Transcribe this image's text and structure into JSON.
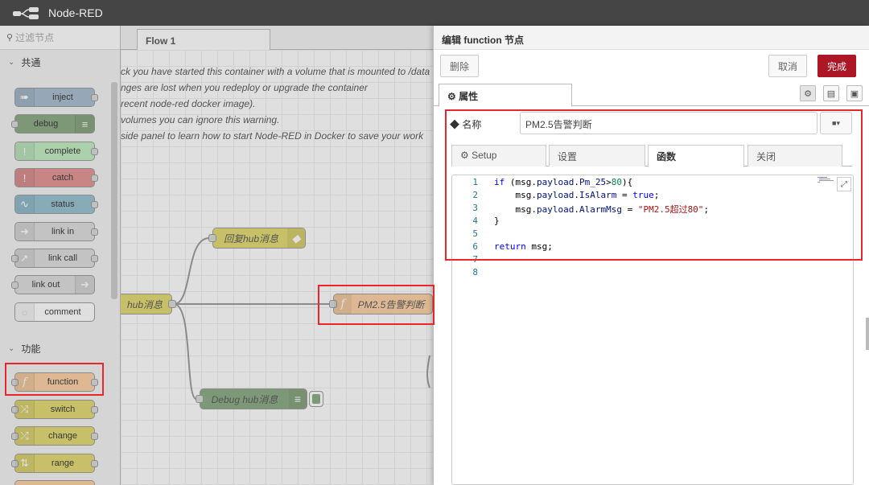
{
  "app": {
    "title": "Node-RED"
  },
  "palette": {
    "search_placeholder": "过滤节点",
    "categories": [
      {
        "label": "共通",
        "nodes": [
          "inject",
          "debug",
          "complete",
          "catch",
          "status",
          "link in",
          "link call",
          "link out",
          "comment"
        ]
      },
      {
        "label": "功能",
        "nodes": [
          "function",
          "switch",
          "change",
          "range"
        ]
      }
    ]
  },
  "workspace": {
    "flow_tab": "Flow 1",
    "warning_lines": [
      "ck you have started this container with a volume that is mounted to /data",
      "nges are lost when you redeploy or upgrade the container",
      " recent node-red docker image).",
      " volumes you can ignore this warning.",
      " side panel to learn how to start Node-RED in Docker to save your work"
    ],
    "nodes": {
      "reply": "回复hub消息",
      "hub_in": "hub消息",
      "function": "PM2.5告警判断",
      "debug": "Debug hub消息"
    }
  },
  "tray": {
    "title": "编辑 function 节点",
    "delete_label": "删除",
    "cancel_label": "取消",
    "done_label": "完成",
    "props_tab": "属性",
    "name_label": "名称",
    "name_value": "PM2.5告警判断",
    "sub_tabs": [
      "Setup",
      "设置",
      "函数",
      "关闭"
    ],
    "code_line_numbers": [
      "1",
      "2",
      "3",
      "4",
      "5",
      "6",
      "7",
      "8"
    ]
  },
  "colors": {
    "header_bg": "#454545",
    "function_node": "#fdd0a2",
    "done_button": "#ad1625",
    "highlight_box": "#e8262b"
  }
}
